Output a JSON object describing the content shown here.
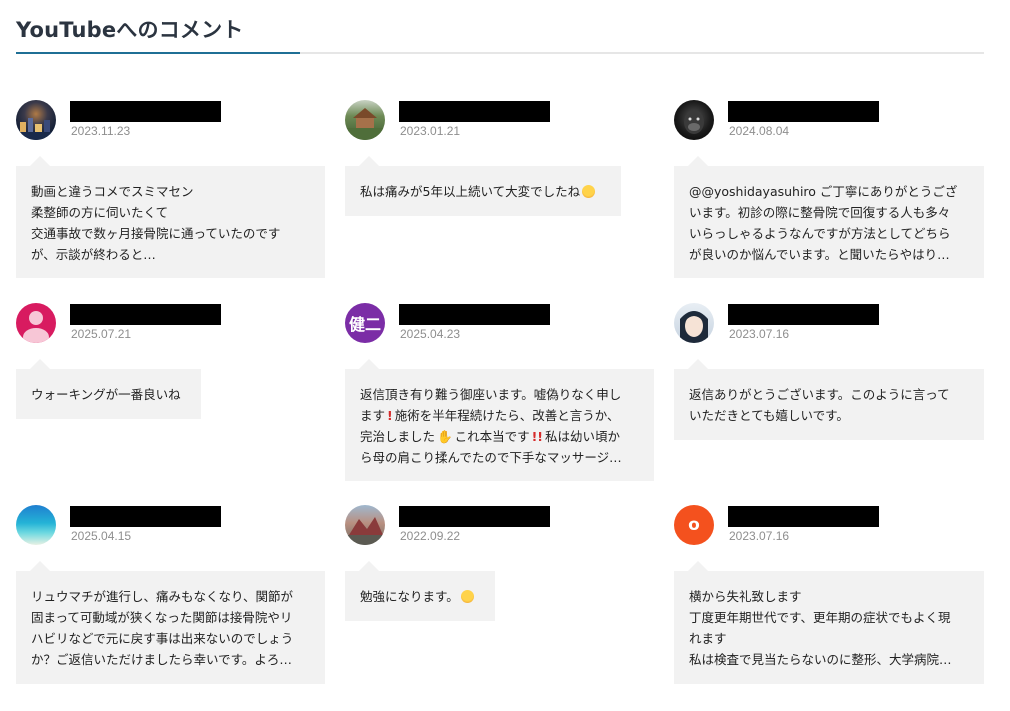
{
  "section": {
    "title": "YouTubeへのコメント"
  },
  "comments": [
    {
      "date": "2023.11.23",
      "avatar_icon": "night-city-photo-avatar",
      "lines": [
        "動画と違うコメでスミマセン",
        "柔整師の方に伺いたくて",
        "交通事故で数ヶ月接骨院に通っていたのです",
        "が、示談が終わると…"
      ]
    },
    {
      "date": "2023.01.21",
      "avatar_icon": "japanese-garden-photo-avatar",
      "lines": [
        "私は痛みが5年以上続いて大変でしたね"
      ]
    },
    {
      "date": "2024.08.04",
      "avatar_icon": "gorilla-photo-avatar",
      "lines": [
        "@@yoshidayasuhiro ご丁寧にありがとうござ",
        "います。初診の際に整骨院で回復する人も多々",
        "いらっしゃるようなんですが方法としてどちら",
        "が良いのか悩んでいます。と聞いたらやはり…"
      ]
    },
    {
      "date": "2025.07.21",
      "avatar_icon": "default-user-avatar",
      "lines": [
        "ウォーキングが一番良いね"
      ]
    },
    {
      "date": "2025.04.23",
      "avatar_text": "健二",
      "lines": [
        "返信頂き有り難う御座います。嘘偽りなく申し",
        "ます",
        "施術を半年程続けたら、改善と言うか、",
        "完治しました",
        "これ本当です",
        "私は幼い頃か",
        "ら母の肩こり揉んでたので下手なマッサージ…"
      ]
    },
    {
      "date": "2023.07.16",
      "avatar_icon": "anime-girl-avatar",
      "lines": [
        "返信ありがとうございます。このように言って",
        "いただきとても嬉しいです。"
      ]
    },
    {
      "date": "2025.04.15",
      "avatar_icon": "ocean-photo-avatar",
      "lines": [
        "リュウマチが進行し、痛みもなくなり、関節が",
        "固まって可動域が狭くなった関節は接骨院やリ",
        "ハビリなどで元に戻す事は出来ないのでしょう",
        "か？ご返信いただけましたら幸いです。よろ…"
      ]
    },
    {
      "date": "2022.09.22",
      "avatar_icon": "landscape-photo-avatar",
      "lines": [
        "勉強になります。"
      ]
    },
    {
      "date": "2023.07.16",
      "avatar_text": "o",
      "lines": [
        "横から失礼致します",
        "丁度更年期世代です、更年期の症状でもよく現",
        "れます",
        "私は検査で見当たらないのに整形、大学病院…"
      ]
    }
  ],
  "colors": {
    "accent": "#1f6f95",
    "bubble_bg": "#f2f2f2",
    "avatar_kenji": "#7b2da6",
    "avatar_o": "#f4511e",
    "avatar_default": "#d81b60"
  }
}
